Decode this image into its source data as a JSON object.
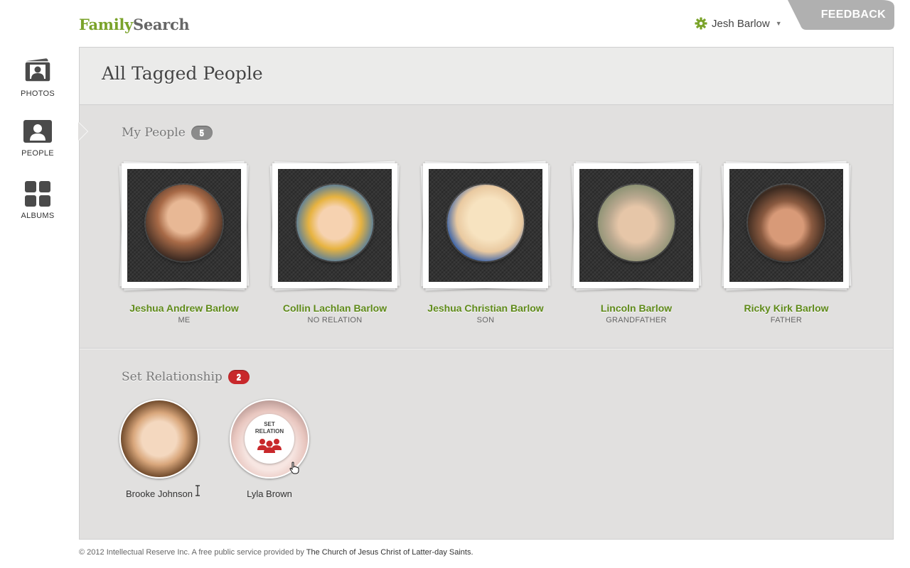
{
  "header": {
    "logo_part1": "Family",
    "logo_part2": "Search",
    "user_name": "Jesh Barlow",
    "user_caret": "▼",
    "feedback_label": "FEEDBACK"
  },
  "sidebar": {
    "items": [
      {
        "label": "PHOTOS",
        "icon": "photos-icon"
      },
      {
        "label": "PEOPLE",
        "icon": "people-icon",
        "active": true
      },
      {
        "label": "ALBUMS",
        "icon": "albums-icon"
      }
    ]
  },
  "main": {
    "title": "All Tagged People",
    "my_people": {
      "title": "My People",
      "count": "5",
      "people": [
        {
          "name": "Jeshua Andrew Barlow",
          "relation": "ME",
          "photo_colors": [
            "#d9a07c",
            "#7a4a30"
          ]
        },
        {
          "name": "Collin Lachlan Barlow",
          "relation": "NO RELATION",
          "photo_colors": [
            "#f2c94c",
            "#2f6fb7"
          ]
        },
        {
          "name": "Jeshua Christian Barlow",
          "relation": "SON",
          "photo_colors": [
            "#f3d9a4",
            "#c0392b"
          ]
        },
        {
          "name": "Lincoln Barlow",
          "relation": "GRANDFATHER",
          "photo_colors": [
            "#d8c3a8",
            "#7d8a6a"
          ]
        },
        {
          "name": "Ricky Kirk Barlow",
          "relation": "FATHER",
          "photo_colors": [
            "#c88b6b",
            "#5a3a2a"
          ]
        }
      ]
    },
    "set_relationship": {
      "title": "Set Relationship",
      "count": "2",
      "people": [
        {
          "name": "Brooke Johnson",
          "photo_colors": [
            "#f2d3b6",
            "#5b3a22"
          ]
        },
        {
          "name": "Lyla Brown",
          "photo_colors": [
            "#f5dede",
            "#b89a9a"
          ],
          "overlay_label_1": "SET",
          "overlay_label_2": "RELATION"
        }
      ]
    }
  },
  "footer": {
    "text": "© 2012 Intellectual Reserve Inc. A free public service provided by ",
    "link": "The Church of Jesus Christ of Latter-day Saints."
  },
  "colors": {
    "brand_green": "#7aa32a",
    "name_green": "#5f8a1a",
    "badge_red": "#c8282b",
    "badge_gray": "#8b8b8b",
    "feedback_gray": "#b0b0b0"
  }
}
